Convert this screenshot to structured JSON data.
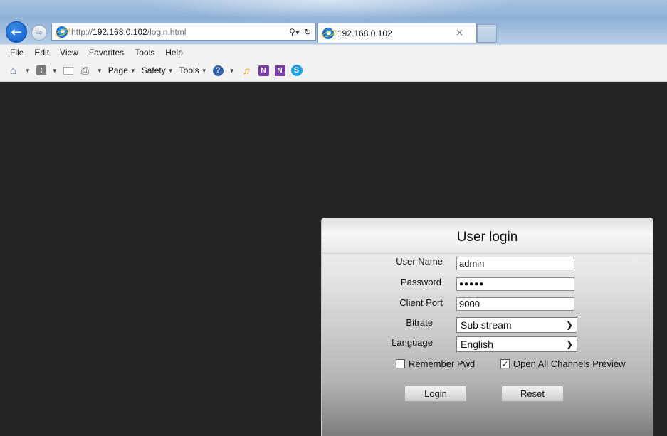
{
  "browser": {
    "address_prefix": "http://",
    "address_host": "192.168.0.102",
    "address_path": "/login.html",
    "search_icon": "search-icon",
    "refresh_icon": "refresh-icon",
    "tab_title": "192.168.0.102",
    "tab_close": "×",
    "menu": [
      "File",
      "Edit",
      "View",
      "Favorites",
      "Tools",
      "Help"
    ],
    "command_bar": {
      "page_label": "Page",
      "safety_label": "Safety",
      "tools_label": "Tools"
    }
  },
  "login": {
    "title": "User login",
    "username_label": "User Name",
    "username_value": "admin",
    "password_label": "Password",
    "password_value": "●●●●●",
    "client_port_label": "Client Port",
    "client_port_value": "9000",
    "bitrate_label": "Bitrate",
    "bitrate_value": "Sub stream",
    "language_label": "Language",
    "language_value": "English",
    "remember_label": "Remember Pwd",
    "remember_checked": false,
    "open_all_label": "Open All Channels Preview",
    "open_all_checked": true,
    "login_button": "Login",
    "reset_button": "Reset"
  },
  "colors": {
    "page_background": "#252525",
    "panel_top": "#f7f7f7",
    "panel_bottom": "#7d7d7d",
    "back_button": "#1466c4"
  }
}
